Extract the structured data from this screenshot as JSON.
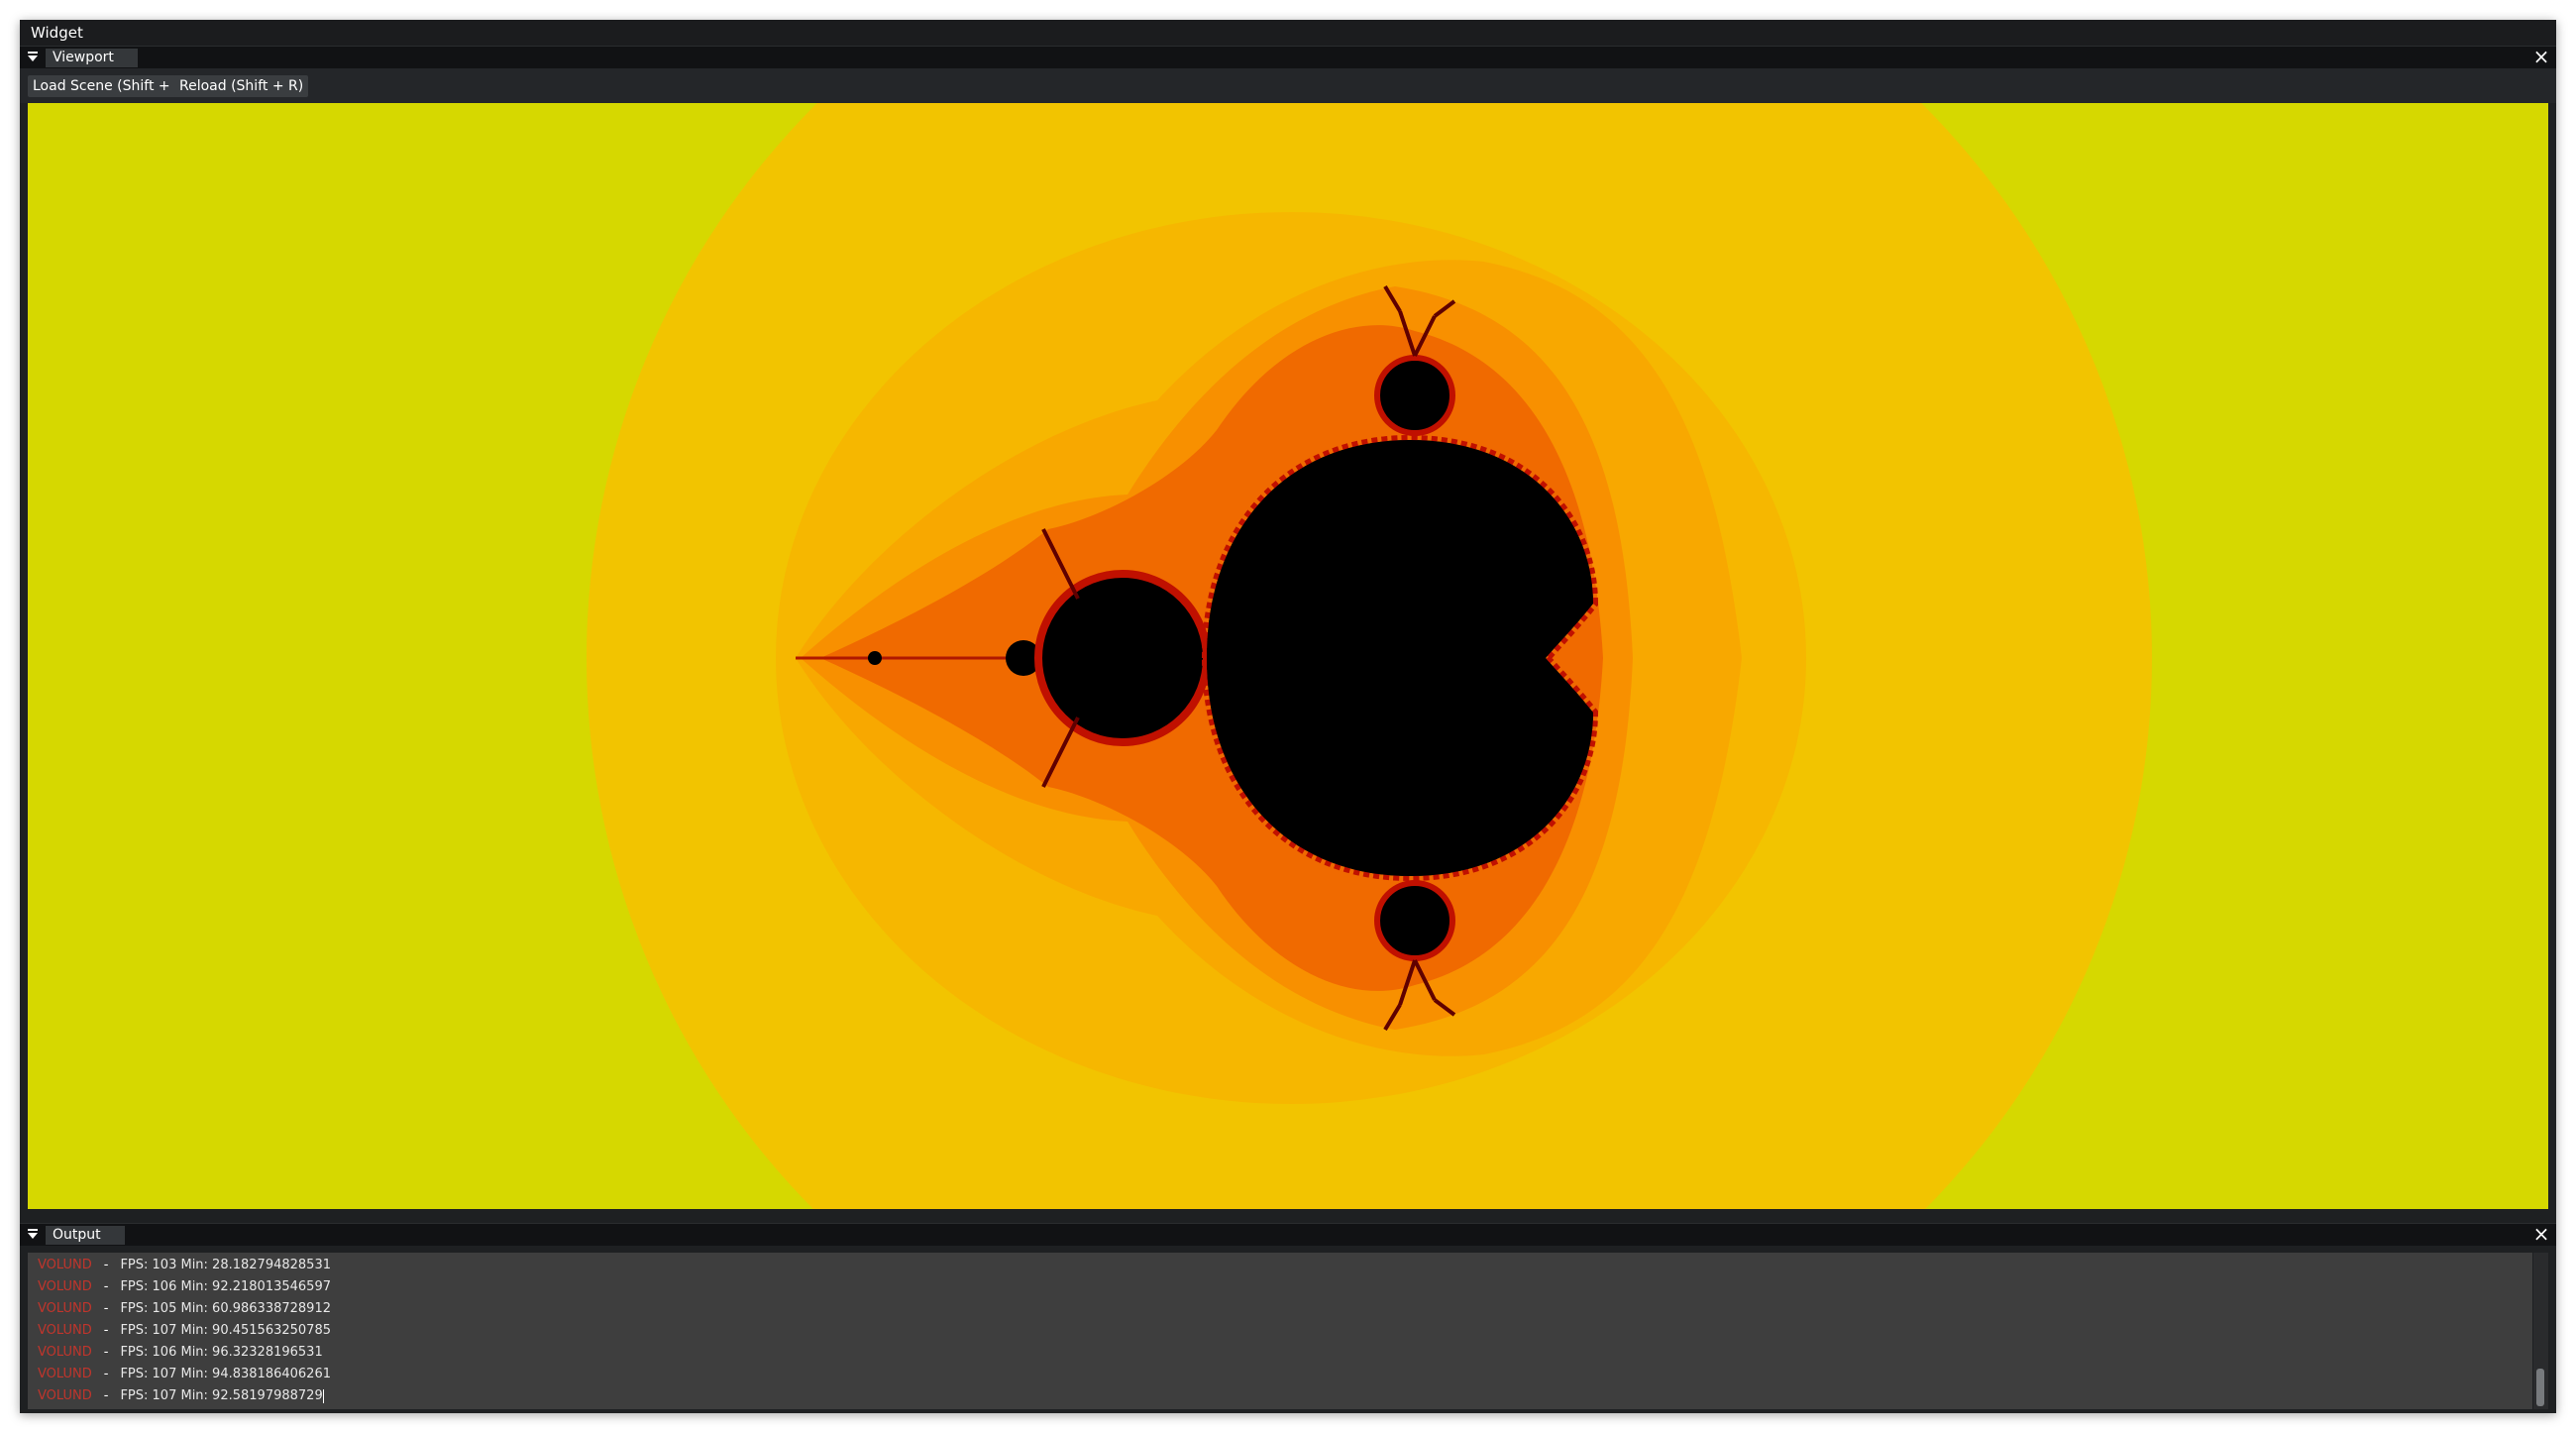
{
  "window": {
    "title": "Widget"
  },
  "viewport_panel": {
    "tab_label": "Viewport",
    "buttons": {
      "load_scene": "Load Scene (Shift + E)",
      "reload": "Reload (Shift + R)"
    }
  },
  "output_panel": {
    "tab_label": "Output",
    "log": [
      {
        "tag": "VOLUND",
        "sep": "-",
        "message": "FPS: 103 Min: 28.182794828531"
      },
      {
        "tag": "VOLUND",
        "sep": "-",
        "message": "FPS: 106 Min: 92.218013546597"
      },
      {
        "tag": "VOLUND",
        "sep": "-",
        "message": "FPS: 105 Min: 60.986338728912"
      },
      {
        "tag": "VOLUND",
        "sep": "-",
        "message": "FPS: 107 Min: 90.451563250785"
      },
      {
        "tag": "VOLUND",
        "sep": "-",
        "message": "FPS: 106 Min: 96.32328196531"
      },
      {
        "tag": "VOLUND",
        "sep": "-",
        "message": "FPS: 107 Min: 94.838186406261"
      },
      {
        "tag": "VOLUND",
        "sep": "-",
        "message": "FPS: 107 Min: 92.58197988729"
      }
    ]
  },
  "icons": {
    "panel_menu": "menu-triangle-icon",
    "close": "close-icon"
  },
  "colors": {
    "fractal_background": "#d6d800",
    "fractal_set": "#000000",
    "log_tag": "#c0352c"
  }
}
